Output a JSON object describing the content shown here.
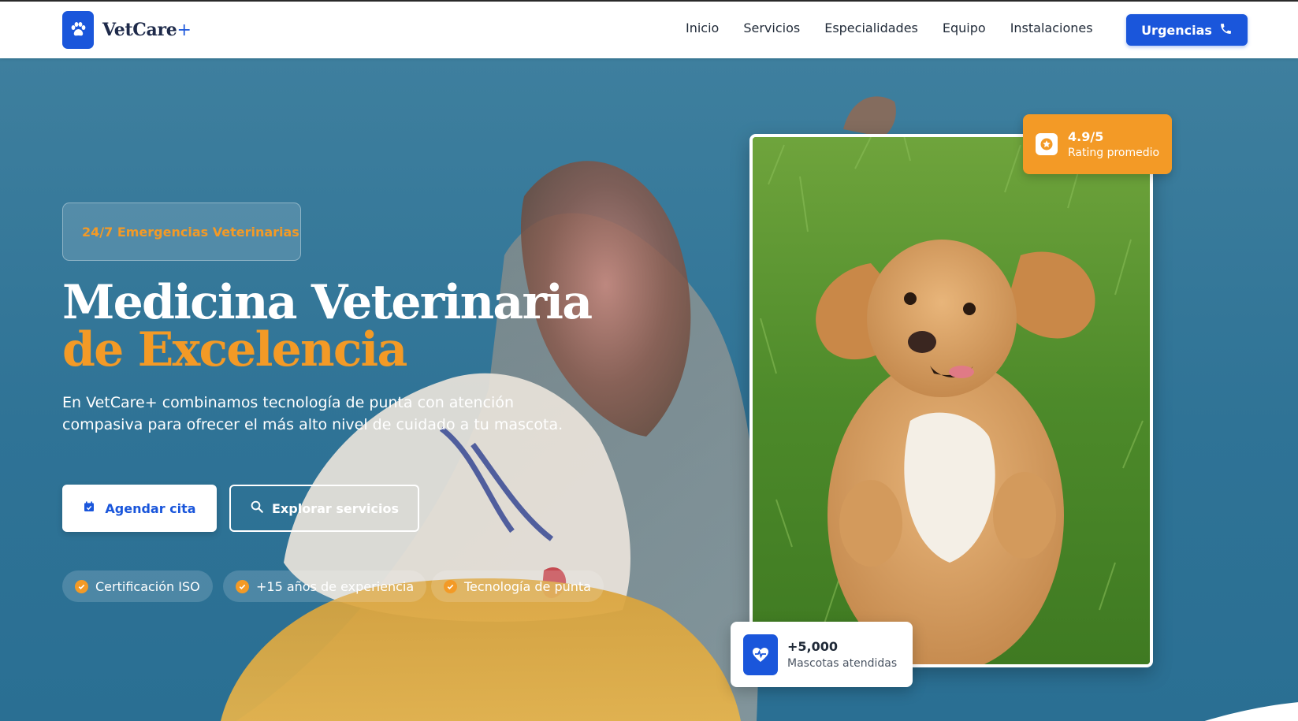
{
  "brand": {
    "name": "VetCare",
    "plus": "+",
    "logo_icon": "paw-icon",
    "primary_color": "#1a56db",
    "accent_color": "#f39a26"
  },
  "nav": {
    "items": [
      {
        "label": "Inicio"
      },
      {
        "label": "Servicios"
      },
      {
        "label": "Especialidades"
      },
      {
        "label": "Equipo"
      },
      {
        "label": "Instalaciones"
      }
    ],
    "cta_label": "Urgencias",
    "cta_icon": "phone-icon"
  },
  "hero": {
    "badge": "24/7 Emergencias Veterinarias",
    "title_part1": "Medicina Veterinaria",
    "title_accent": "de Excelencia",
    "description": "En VetCare+ combinamos tecnología de punta con atención compasiva para ofrecer el más alto nivel de cuidado a tu mascota.",
    "primary_button": {
      "label": "Agendar cita",
      "icon": "calendar-icon"
    },
    "secondary_button": {
      "label": "Explorar servicios",
      "icon": "search-icon"
    },
    "features": [
      {
        "label": "Certificación ISO",
        "icon": "check-circle-icon"
      },
      {
        "label": "+15 años de experiencia",
        "icon": "check-circle-icon"
      },
      {
        "label": "Tecnología de punta",
        "icon": "check-circle-icon"
      }
    ]
  },
  "rating": {
    "value": "4.9/5",
    "label": "Rating promedio",
    "icon": "star-icon"
  },
  "stats": {
    "value": "+5,000",
    "label": "Mascotas atendidas",
    "icon": "heart-pulse-icon"
  }
}
